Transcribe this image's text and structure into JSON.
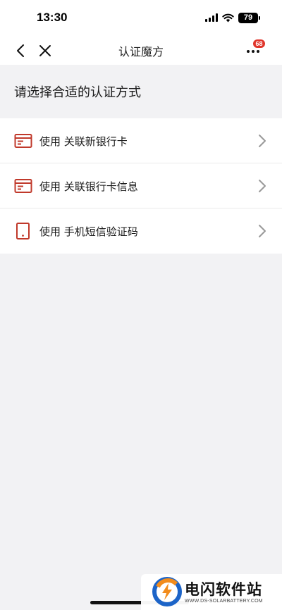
{
  "status_bar": {
    "time": "13:30",
    "battery": "79"
  },
  "nav": {
    "title": "认证魔方",
    "more_badge": "68",
    "back_icon": "chevron-left-icon",
    "close_icon": "close-icon",
    "more_icon": "more-dots-icon"
  },
  "section": {
    "title": "请选择合适的认证方式"
  },
  "options": [
    {
      "label": "使用 关联新银行卡",
      "icon": "bank-card-icon"
    },
    {
      "label": "使用 关联银行卡信息",
      "icon": "bank-card-icon"
    },
    {
      "label": "使用 手机短信验证码",
      "icon": "phone-icon"
    }
  ],
  "watermark": {
    "title": "电闪软件站",
    "url": "WWW.DS-SOLARBATTERY.COM"
  },
  "colors": {
    "accent": "#c0392b",
    "badge": "#e0352b",
    "background": "#f2f2f4"
  }
}
